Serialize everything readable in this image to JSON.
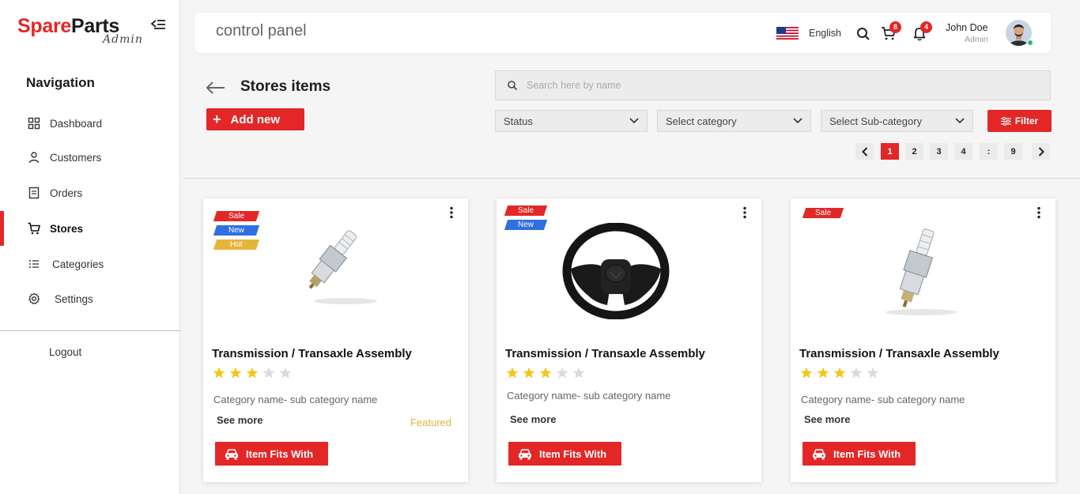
{
  "brand": {
    "name_red": "Spare",
    "name_dark": "Parts",
    "subtitle": "Admin",
    "accent_color": "#e32727"
  },
  "sidebar": {
    "title": "Navigation",
    "items": [
      {
        "label": "Dashboard",
        "icon": "grid-icon"
      },
      {
        "label": "Customers",
        "icon": "user-icon"
      },
      {
        "label": "Orders",
        "icon": "receipt-icon"
      },
      {
        "label": "Stores",
        "icon": "cart-icon",
        "active": true
      },
      {
        "label": "Categories",
        "icon": "list-icon"
      },
      {
        "label": "Settings",
        "icon": "gear-icon"
      }
    ],
    "logout": "Logout"
  },
  "header": {
    "title": "control panel",
    "language": "English",
    "cart_count": "8",
    "notification_count": "4",
    "user_name": "John Doe",
    "user_role": "Admin"
  },
  "page": {
    "title": "Stores items",
    "add_label": "Add new",
    "search_placeholder": "Search here by name",
    "filters": {
      "status": "Status",
      "category": "Select category",
      "subcategory": "Select Sub-category",
      "button": "Filter"
    },
    "pagination": [
      "1",
      "2",
      "3",
      "4",
      ":",
      "9"
    ],
    "current_page": "1"
  },
  "products": [
    {
      "tags": [
        "Sale",
        "New",
        "Hot"
      ],
      "name": "Transmission / Transaxle Assembly",
      "rating": 3,
      "max_rating": 5,
      "category": "Category name- sub category name",
      "see_more": "See more",
      "featured": "Featured",
      "button": "Item Fits With",
      "image": "spark-plug"
    },
    {
      "tags": [
        "Sale",
        "New"
      ],
      "name": "Transmission / Transaxle Assembly",
      "rating": 3,
      "max_rating": 5,
      "category": "Category name- sub category name",
      "see_more": "See more",
      "button": "Item Fits With",
      "image": "steering-wheel"
    },
    {
      "tags": [
        "Sale"
      ],
      "name": "Transmission / Transaxle Assembly",
      "rating": 3,
      "max_rating": 5,
      "category": "Category name- sub category name",
      "see_more": "See more",
      "button": "Item Fits With",
      "image": "spark-plug"
    }
  ]
}
